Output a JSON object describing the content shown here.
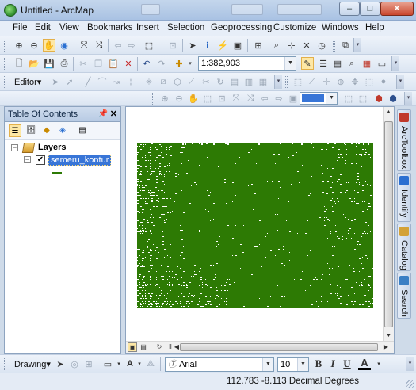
{
  "window": {
    "title": "Untitled - ArcMap",
    "minimize": "–",
    "maximize": "□",
    "close": "✕"
  },
  "menu": [
    "File",
    "Edit",
    "View",
    "Bookmarks",
    "Insert",
    "Selection",
    "Geoprocessing",
    "Customize",
    "Windows",
    "Help"
  ],
  "standard_toolbar": {
    "scale_value": "1:382,903"
  },
  "editor_toolbar": {
    "editor_label": "Editor▾"
  },
  "toc": {
    "title": "Table Of Contents",
    "pin": "ᵖ",
    "close": "✕",
    "root_label": "Layers",
    "layer_label": "semeru_kontur",
    "layer_checked": true,
    "layer_color": "#2d7a04"
  },
  "map": {
    "feature_color": "#2d7a04",
    "background": "#ffffff"
  },
  "dock_tabs": [
    {
      "label": "ArcToolbox",
      "icon": "toolbox-icon",
      "color": "#c0392b"
    },
    {
      "label": "Identify",
      "icon": "identify-icon",
      "color": "#2a6fd1"
    },
    {
      "label": "Catalog",
      "icon": "catalog-icon",
      "color": "#d3a237"
    },
    {
      "label": "Search",
      "icon": "search-icon",
      "color": "#3a7fc4"
    }
  ],
  "draw_toolbar": {
    "drawing_label": "Drawing▾",
    "font_name": "Arial",
    "font_size": "10",
    "bold": "B",
    "italic": "I",
    "underline": "U",
    "font_color_letter": "A"
  },
  "status": {
    "coordinates": "112.783  -8.113 Decimal Degrees"
  }
}
